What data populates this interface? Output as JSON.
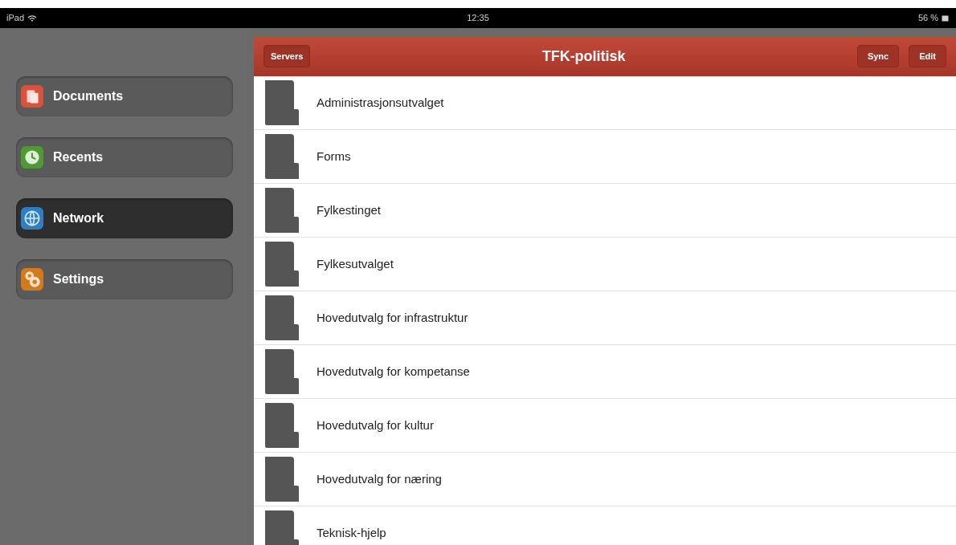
{
  "status_bar": {
    "device": "iPad",
    "time": "12:35",
    "battery": "56 %"
  },
  "sidebar": {
    "items": [
      {
        "label": "Documents",
        "kind": "documents",
        "selected": false
      },
      {
        "label": "Recents",
        "kind": "recents",
        "selected": false
      },
      {
        "label": "Network",
        "kind": "network",
        "selected": true
      },
      {
        "label": "Settings",
        "kind": "settings",
        "selected": false
      }
    ]
  },
  "nav_bar": {
    "left_button": "Servers",
    "title": "TFK-politisk",
    "right_buttons": [
      "Sync",
      "Edit"
    ]
  },
  "folders": [
    {
      "name": "Administrasjonsutvalget"
    },
    {
      "name": "Forms"
    },
    {
      "name": "Fylkestinget"
    },
    {
      "name": "Fylkesutvalget"
    },
    {
      "name": "Hovedutvalg for infrastruktur"
    },
    {
      "name": "Hovedutvalg for kompetanse"
    },
    {
      "name": "Hovedutvalg for kultur"
    },
    {
      "name": "Hovedutvalg for næring"
    },
    {
      "name": "Teknisk-hjelp"
    }
  ]
}
